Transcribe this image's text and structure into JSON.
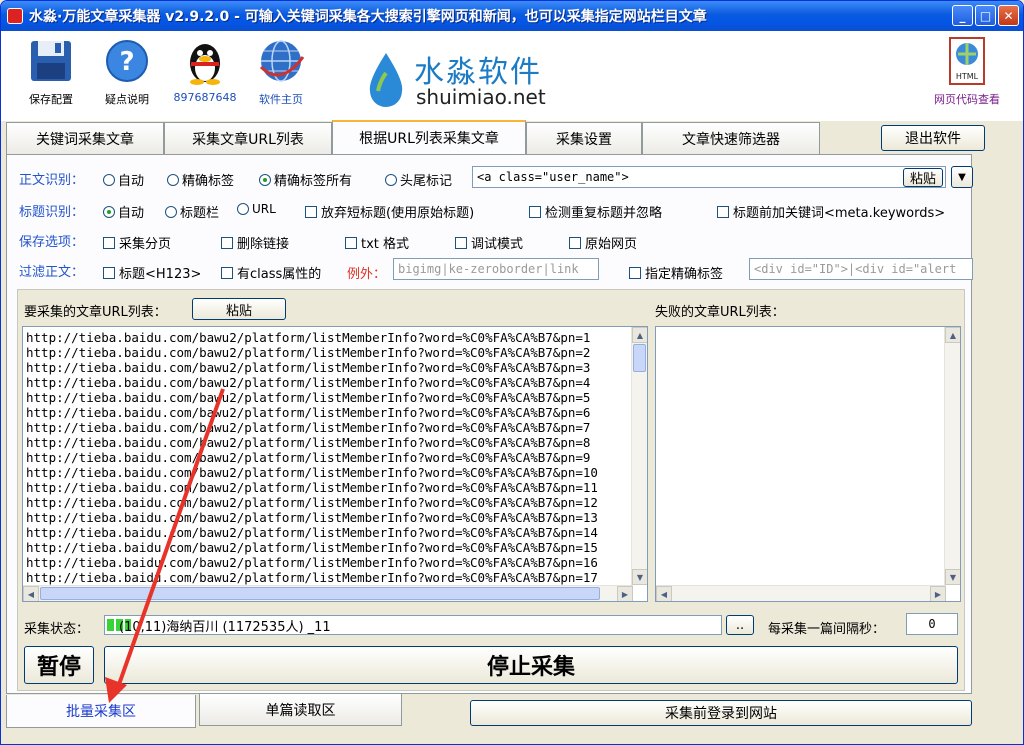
{
  "window": {
    "title": "水淼·万能文章采集器 v2.9.2.0 - 可输入关键词采集各大搜索引擎网页和新闻，也可以采集指定网站栏目文章",
    "controls": [
      "minimize",
      "maximize",
      "close"
    ]
  },
  "toolbar": {
    "save_label": "保存配置",
    "help_label": "疑点说明",
    "qq_label": "897687648",
    "home_label": "软件主页",
    "html_label": "网页代码查看",
    "html_badge": "HTML",
    "logo_cn": "水淼软件",
    "logo_en": "shuimiao.net"
  },
  "tabs": [
    {
      "label": "关键词采集文章"
    },
    {
      "label": "采集文章URL列表"
    },
    {
      "label": "根据URL列表采集文章"
    },
    {
      "label": "采集设置"
    },
    {
      "label": "文章快速筛选器"
    }
  ],
  "exit_label": "退出软件",
  "body_detect": {
    "label": "正文识别：",
    "options": [
      "自动",
      "精确标签",
      "精确标签所有",
      "头尾标记"
    ],
    "selected": "精确标签所有",
    "value": "<a class=\"user_name\">",
    "paste_label": "粘贴",
    "dropdown_icon": "▼"
  },
  "title_detect": {
    "label": "标题识别：",
    "options": [
      "自动",
      "标题栏",
      "URL"
    ],
    "selected": "自动",
    "checks": [
      "放弃短标题(使用原始标题)",
      "检测重复标题并忽略",
      "标题前加关键词<meta.keywords>"
    ]
  },
  "save_options": {
    "label": "保存选项：",
    "checks": [
      "采集分页",
      "删除链接",
      "txt 格式",
      "调试模式",
      "原始网页"
    ]
  },
  "filter": {
    "label": "过滤正文：",
    "check1": "标题<H123>",
    "check2": "有class属性的",
    "exception_label": "例外：",
    "exception_value": "bigimg|ke-zeroborder|link",
    "check3": "指定精确标签",
    "tag_value": "<div id=\"ID\">|<div id=\"alert"
  },
  "url_list": {
    "label": "要采集的文章URL列表：",
    "paste_label": "粘贴",
    "urls": [
      "http://tieba.baidu.com/bawu2/platform/listMemberInfo?word=%C0%FA%CA%B7&pn=1",
      "http://tieba.baidu.com/bawu2/platform/listMemberInfo?word=%C0%FA%CA%B7&pn=2",
      "http://tieba.baidu.com/bawu2/platform/listMemberInfo?word=%C0%FA%CA%B7&pn=3",
      "http://tieba.baidu.com/bawu2/platform/listMemberInfo?word=%C0%FA%CA%B7&pn=4",
      "http://tieba.baidu.com/bawu2/platform/listMemberInfo?word=%C0%FA%CA%B7&pn=5",
      "http://tieba.baidu.com/bawu2/platform/listMemberInfo?word=%C0%FA%CA%B7&pn=6",
      "http://tieba.baidu.com/bawu2/platform/listMemberInfo?word=%C0%FA%CA%B7&pn=7",
      "http://tieba.baidu.com/bawu2/platform/listMemberInfo?word=%C0%FA%CA%B7&pn=8",
      "http://tieba.baidu.com/bawu2/platform/listMemberInfo?word=%C0%FA%CA%B7&pn=9",
      "http://tieba.baidu.com/bawu2/platform/listMemberInfo?word=%C0%FA%CA%B7&pn=10",
      "http://tieba.baidu.com/bawu2/platform/listMemberInfo?word=%C0%FA%CA%B7&pn=11",
      "http://tieba.baidu.com/bawu2/platform/listMemberInfo?word=%C0%FA%CA%B7&pn=12",
      "http://tieba.baidu.com/bawu2/platform/listMemberInfo?word=%C0%FA%CA%B7&pn=13",
      "http://tieba.baidu.com/bawu2/platform/listMemberInfo?word=%C0%FA%CA%B7&pn=14",
      "http://tieba.baidu.com/bawu2/platform/listMemberInfo?word=%C0%FA%CA%B7&pn=15",
      "http://tieba.baidu.com/bawu2/platform/listMemberInfo?word=%C0%FA%CA%B7&pn=16",
      "http://tieba.baidu.com/bawu2/platform/listMemberInfo?word=%C0%FA%CA%B7&pn=17"
    ]
  },
  "failed_list": {
    "label": "失败的文章URL列表："
  },
  "status": {
    "label": "采集状态：",
    "text": "(10,11)海纳百川          (1172535人) _11",
    "progress": 0.04,
    "more_label": "..",
    "interval_label": "每采集一篇间隔秒：",
    "interval_value": "0"
  },
  "pause_label": "暂停",
  "stop_label": "停止采集",
  "bottom_tabs": {
    "batch": "批量采集区",
    "single": "单篇读取区",
    "login": "采集前登录到网站"
  },
  "colors": {
    "accent_blue": "#2255cc",
    "annotation_red": "#e8332a"
  }
}
